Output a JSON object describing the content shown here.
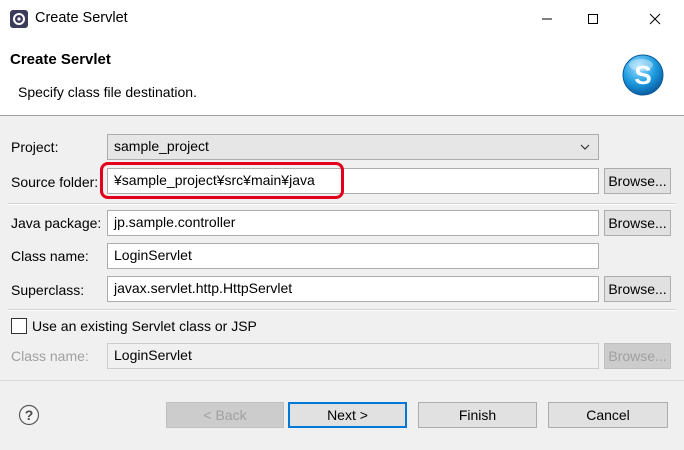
{
  "window": {
    "title": "Create Servlet",
    "icons": {
      "app": "eclipse-gear-icon",
      "minimize": "minimize-icon",
      "maximize": "maximize-icon",
      "close": "close-icon"
    }
  },
  "banner": {
    "title": "Create Servlet",
    "description": "Specify class file destination.",
    "logo": "servlet-s-logo-icon"
  },
  "form": {
    "project": {
      "label": "Project:",
      "value": "sample_project"
    },
    "source_folder": {
      "label": "Source folder:",
      "value": "¥sample_project¥src¥main¥java",
      "browse": "Browse..."
    },
    "java_package": {
      "label": "Java package:",
      "value": "jp.sample.controller",
      "browse": "Browse..."
    },
    "class_name": {
      "label": "Class name:",
      "value": "LoginServlet"
    },
    "superclass": {
      "label": "Superclass:",
      "value": "javax.servlet.http.HttpServlet",
      "browse": "Browse..."
    },
    "use_existing": {
      "label": "Use an existing Servlet class or JSP",
      "checked": false
    },
    "existing_class_name": {
      "label": "Class name:",
      "value": "LoginServlet",
      "browse": "Browse..."
    }
  },
  "footer": {
    "help_icon": "help-question-icon",
    "back": "< Back",
    "next": "Next >",
    "finish": "Finish",
    "cancel": "Cancel"
  },
  "colors": {
    "highlight": "#e3001b",
    "accent": "#0078d7"
  }
}
